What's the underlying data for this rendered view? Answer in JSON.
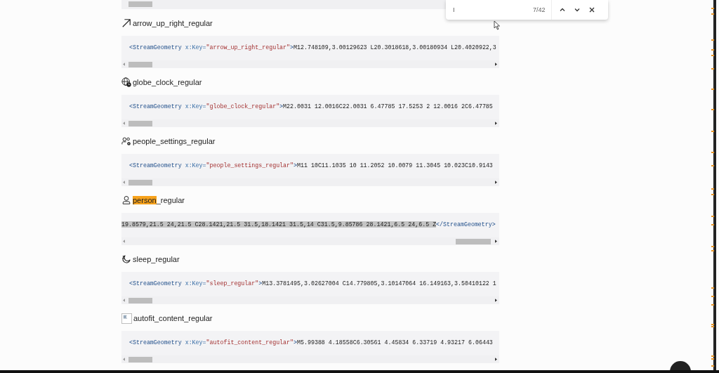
{
  "find_bar": {
    "query": "I",
    "count": "7/42"
  },
  "entries": [
    {
      "kind": "arrow",
      "title": [
        {
          "text": "arrow_up_right_regular",
          "highlighted": false
        }
      ],
      "scrolled_to_end": false,
      "code": [
        {
          "kind": "tag",
          "text": "<StreamGeometry"
        },
        {
          "kind": "attr",
          "text": " x:Key="
        },
        {
          "kind": "string",
          "text": "\"arrow_up_right_regular\""
        },
        {
          "kind": "tag",
          "text": ">"
        },
        {
          "kind": "text",
          "text": "M12.748109,3.00129623 L20.3018618,3.00180934 L20.4020922,3"
        }
      ]
    },
    {
      "kind": "globe-clock",
      "title": [
        {
          "text": "globe_clock_regular",
          "highlighted": false
        }
      ],
      "scrolled_to_end": false,
      "code": [
        {
          "kind": "tag",
          "text": "<StreamGeometry"
        },
        {
          "kind": "attr",
          "text": " x:Key="
        },
        {
          "kind": "string",
          "text": "\"globe_clock_regular\""
        },
        {
          "kind": "tag",
          "text": ">"
        },
        {
          "kind": "text",
          "text": "M22.0031 12.0016C22.0031 6.47785 17.5253 2 12.0016 2C6.47785"
        }
      ]
    },
    {
      "kind": "people-settings",
      "title": [
        {
          "text": "people_settings_regular",
          "highlighted": false
        }
      ],
      "scrolled_to_end": false,
      "code": [
        {
          "kind": "tag",
          "text": "<StreamGeometry"
        },
        {
          "kind": "attr",
          "text": " x:Key="
        },
        {
          "kind": "string",
          "text": "\"people_settings_regular\""
        },
        {
          "kind": "tag",
          "text": ">"
        },
        {
          "kind": "text",
          "text": "M11 10C11.1035 10 11.2052 10.0079 11.3045 10.023C10.9143"
        }
      ]
    },
    {
      "kind": "person",
      "title": [
        {
          "text": "person",
          "highlighted": true
        },
        {
          "text": "_regular",
          "highlighted": false
        }
      ],
      "scrolled_to_end": true,
      "code": [
        {
          "kind": "selected",
          "text": "19.8579,21.5 24,21.5 C28.1421,21.5 31.5,18.1421 31.5,14 C31.5,9.85786 28.1421,6.5 24,6.5 Z"
        },
        {
          "kind": "tag",
          "text": "</StreamGeometry>"
        }
      ]
    },
    {
      "kind": "sleep",
      "title": [
        {
          "text": "sleep_regular",
          "highlighted": false
        }
      ],
      "scrolled_to_end": false,
      "code": [
        {
          "kind": "tag",
          "text": "<StreamGeometry"
        },
        {
          "kind": "attr",
          "text": " x:Key="
        },
        {
          "kind": "string",
          "text": "\"sleep_regular\""
        },
        {
          "kind": "tag",
          "text": ">"
        },
        {
          "kind": "text",
          "text": "M13.3781495,3.02627004 C14.779805,3.10147064 16.149163,3.50410122 1"
        }
      ]
    },
    {
      "kind": "broken-image",
      "title": [
        {
          "text": "autofit_content_regular",
          "highlighted": false
        }
      ],
      "scrolled_to_end": false,
      "code": [
        {
          "kind": "tag",
          "text": "<StreamGeometry"
        },
        {
          "kind": "attr",
          "text": " x:Key="
        },
        {
          "kind": "string",
          "text": "\"autofit_content_regular\""
        },
        {
          "kind": "tag",
          "text": ">"
        },
        {
          "kind": "text",
          "text": "M5.99388 4.18558C6.30561 4.45834 6.33719 4.93217 6.06443"
        }
      ]
    }
  ]
}
